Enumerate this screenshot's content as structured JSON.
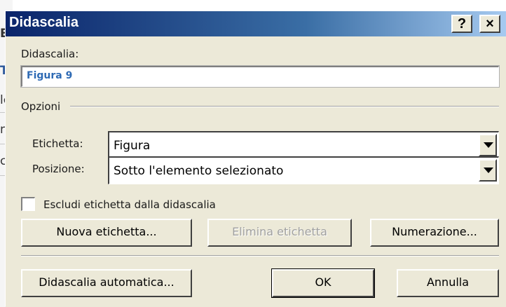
{
  "background": {
    "fragments": [
      "E",
      "T",
      "lc",
      "n",
      "c"
    ]
  },
  "dialog": {
    "title": "Didascalia",
    "help_glyph": "?",
    "close_glyph": "×",
    "caption_label": "Didascalia:",
    "caption_value": "Figura 9",
    "options_group": "Opzioni",
    "label_field": {
      "label": "Etichetta:",
      "value": "Figura"
    },
    "position_field": {
      "label": "Posizione:",
      "value": "Sotto l'elemento selezionato"
    },
    "exclude_checkbox": {
      "label": "Escludi etichetta dalla didascalia",
      "checked": false
    },
    "buttons": {
      "new_label": "Nuova etichetta...",
      "delete_label": "Elimina etichetta",
      "numbering": "Numerazione...",
      "auto_caption": "Didascalia automatica...",
      "ok": "OK",
      "cancel": "Annulla"
    }
  },
  "colors": {
    "title_bar_start": "#0a246a",
    "title_bar_end": "#a6caf0",
    "dialog_bg": "#ece9d8",
    "caption_text": "#2e6ab4"
  }
}
